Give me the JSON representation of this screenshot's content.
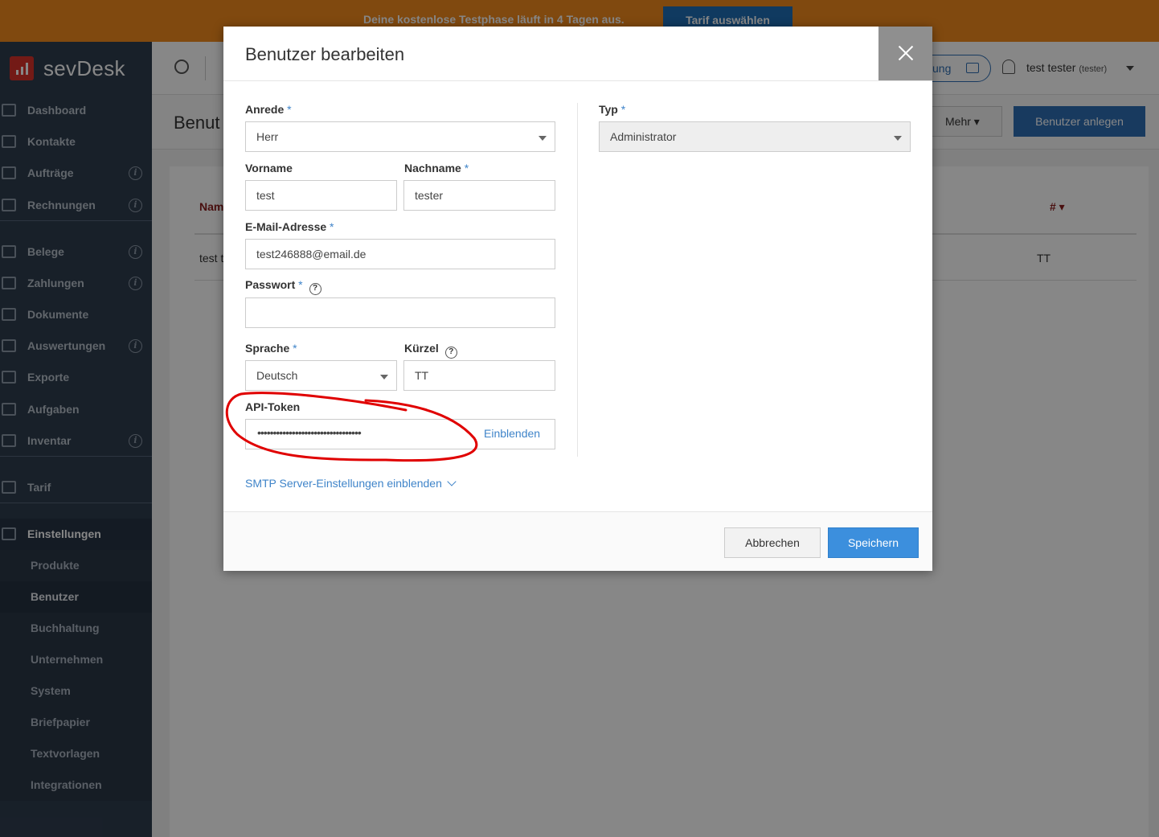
{
  "banner": {
    "text": "Deine kostenlose Testphase läuft in 4 Tagen aus.",
    "button": "Tarif auswählen"
  },
  "brand": {
    "name": "sevDesk"
  },
  "sidebar": {
    "items": [
      {
        "label": "Dashboard",
        "icon": "dashboard-icon",
        "info": false
      },
      {
        "label": "Kontakte",
        "icon": "contacts-icon",
        "info": false
      },
      {
        "label": "Aufträge",
        "icon": "folder-icon",
        "info": true
      },
      {
        "label": "Rechnungen",
        "icon": "document-icon",
        "info": true
      },
      {
        "label": "Belege",
        "icon": "receipt-icon",
        "info": true
      },
      {
        "label": "Zahlungen",
        "icon": "card-icon",
        "info": true
      },
      {
        "label": "Dokumente",
        "icon": "calendar-icon",
        "info": false
      },
      {
        "label": "Auswertungen",
        "icon": "wallet-icon",
        "info": true
      },
      {
        "label": "Exporte",
        "icon": "export-icon",
        "info": false
      },
      {
        "label": "Aufgaben",
        "icon": "check-icon",
        "info": false
      },
      {
        "label": "Inventar",
        "icon": "box-icon",
        "info": true
      },
      {
        "label": "Tarif",
        "icon": "chart-icon",
        "info": false
      },
      {
        "label": "Einstellungen",
        "icon": "gear-icon",
        "info": false
      }
    ],
    "sub_items": [
      "Produkte",
      "Benutzer",
      "Buchhaltung",
      "Unternehmen",
      "System",
      "Briefpapier",
      "Textvorlagen",
      "Integrationen"
    ],
    "active_sub": "Benutzer",
    "info_glyph": "i"
  },
  "topbar": {
    "help_label": "ung",
    "user_name": "test tester",
    "user_handle": "(tester)"
  },
  "page": {
    "title": "Benut",
    "mehr_label": "Mehr ▾",
    "create_label": "Benutzer anlegen",
    "table": {
      "col_name": "Nam",
      "col_num": "# ▾",
      "row_name": "test t",
      "row_num": "TT"
    }
  },
  "modal": {
    "title": "Benutzer bearbeiten",
    "required_mark": "*",
    "help_glyph": "?",
    "fields": {
      "anrede": {
        "label": "Anrede",
        "value": "Herr"
      },
      "vorname": {
        "label": "Vorname",
        "value": "test"
      },
      "nachname": {
        "label": "Nachname",
        "value": "tester"
      },
      "email": {
        "label": "E-Mail-Adresse",
        "value": "test246888@email.de"
      },
      "passwort": {
        "label": "Passwort",
        "value": ""
      },
      "sprache": {
        "label": "Sprache",
        "value": "Deutsch"
      },
      "kuerzel": {
        "label": "Kürzel",
        "value": "TT"
      },
      "api_token": {
        "label": "API-Token",
        "value": "•••••••••••••••••••••••••••••••••",
        "reveal": "Einblenden"
      },
      "typ": {
        "label": "Typ",
        "value": "Administrator"
      }
    },
    "smtp_link": "SMTP Server-Einstellungen einblenden",
    "cancel": "Abbrechen",
    "save": "Speichern"
  },
  "colors": {
    "banner": "#f28a1e",
    "primary": "#3c8fdd",
    "sidebar": "#2f3d4f",
    "annotation": "#e00000"
  }
}
